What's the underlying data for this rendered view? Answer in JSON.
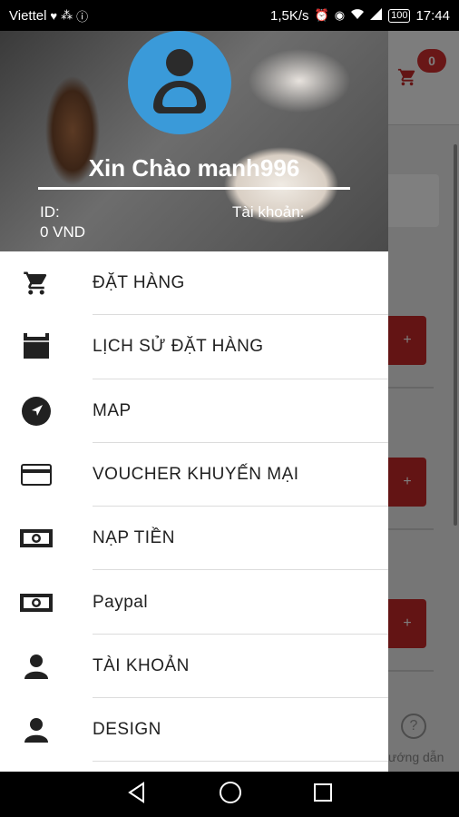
{
  "status_bar": {
    "carrier": "Viettel",
    "speed": "1,5K/s",
    "battery": "100",
    "time": "17:44"
  },
  "header": {
    "greeting": "Xin Chào manh996",
    "id_label": "ID:",
    "balance": "0 VND",
    "account_label": "Tài khoản:"
  },
  "menu": {
    "items": [
      {
        "label": "ĐẶT HÀNG",
        "icon": "cart-icon"
      },
      {
        "label": "LỊCH SỬ ĐẶT HÀNG",
        "icon": "calendar-icon"
      },
      {
        "label": "MAP",
        "icon": "navigation-icon"
      },
      {
        "label": "VOUCHER KHUYẾN MẠI",
        "icon": "credit-card-icon"
      },
      {
        "label": "NẠP TIỀN",
        "icon": "money-icon"
      },
      {
        "label": "Paypal",
        "icon": "money-icon"
      },
      {
        "label": "TÀI KHOẢN",
        "icon": "person-icon"
      },
      {
        "label": "DESIGN",
        "icon": "person-icon"
      }
    ]
  },
  "background_app": {
    "cart_badge": "0",
    "plus_label": "+",
    "help_label": "ướng dẫn"
  }
}
